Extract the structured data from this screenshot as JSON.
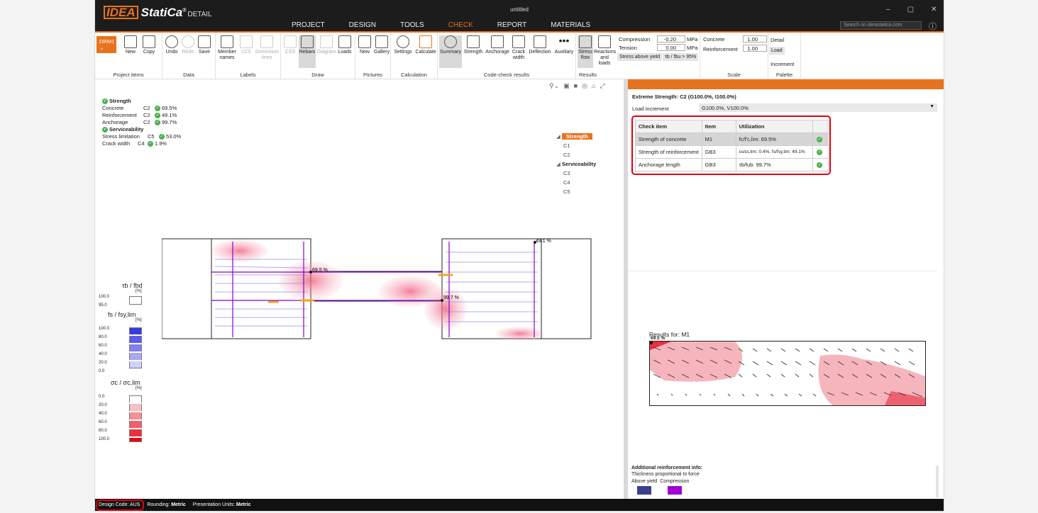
{
  "app": {
    "brand": "IDEA",
    "product": "StatiCa",
    "registered": "®",
    "module": "DETAIL",
    "doc_title": "untitled"
  },
  "menu": [
    {
      "label": "PROJECT"
    },
    {
      "label": "DESIGN"
    },
    {
      "label": "TOOLS"
    },
    {
      "label": "CHECK",
      "active": true
    },
    {
      "label": "REPORT"
    },
    {
      "label": "MATERIALS"
    }
  ],
  "search": {
    "placeholder": "Search on ideastatica.com"
  },
  "ribbon": {
    "project": {
      "drm": "DRM1",
      "new": "New",
      "copy": "Copy",
      "label": "Project items"
    },
    "data": {
      "undo": "Undo",
      "redo": "Redo",
      "save": "Save",
      "label": "Data"
    },
    "labels": {
      "member": "Member names",
      "lcs": "LCS",
      "dimension": "Dimension lines",
      "label": "Labels"
    },
    "draw": {
      "css": "CSS",
      "rebars": "Rebars",
      "diagram": "Diagram",
      "loads": "Loads",
      "label": "Draw"
    },
    "pictures": {
      "new": "New",
      "gallery": "Gallery",
      "label": "Pictures"
    },
    "calculation": {
      "settings": "Settings",
      "calculate": "Calculate",
      "label": "Calculation"
    },
    "code": {
      "summary": "Summary",
      "strength": "Strength",
      "anchorage": "Anchorage",
      "crack": "Crack width",
      "deflection": "Deflection",
      "auxiliary": "Auxiliary",
      "label": "Code-check results"
    },
    "results": {
      "stress_flow": "Stress flow",
      "reactions": "Reactions and loads",
      "compression": "Compression",
      "tension": "Tension",
      "comp_val": "-0.20",
      "tens_val": "0.00",
      "unit": "MPa",
      "stress_yield": "Stress above yield",
      "tb_ratio": "τb / fbu > 95%",
      "label": "Results"
    },
    "scale": {
      "concrete": "Concrete",
      "reinforcement": "Reinforcement",
      "concrete_val": "1.00",
      "reinf_val": "1.00",
      "label": "Scale"
    },
    "palette": {
      "detail": "Detail",
      "load": "Load",
      "increment": "Increment",
      "label": "Palette"
    }
  },
  "summary": {
    "strength_title": "Strength",
    "rows": [
      {
        "name": "Concrete",
        "case": "C2",
        "value": "69.5%"
      },
      {
        "name": "Reinforcement",
        "case": "C2",
        "value": "49.1%"
      },
      {
        "name": "Anchorage",
        "case": "C2",
        "value": "99.7%"
      }
    ],
    "serviceability_title": "Serviceability",
    "srows": [
      {
        "name": "Stress limitation",
        "case": "C5",
        "value": "53.0%"
      },
      {
        "name": "Crack width",
        "case": "C4",
        "value": "1.9%"
      }
    ]
  },
  "tree": {
    "strength": "Strength",
    "c1": "C1",
    "c2": "C2",
    "serviceability": "Serviceability",
    "c3": "C3",
    "c4": "C4",
    "c5": "C5"
  },
  "drawing": {
    "labels": {
      "a": "69.5 %",
      "b": "49.1 %",
      "c": "99.7 %"
    }
  },
  "legend": {
    "tb": {
      "title": "τb / fbd",
      "unit": "[%]",
      "values": [
        "100.0",
        "95.0"
      ],
      "color": "#f5a31a"
    },
    "fs": {
      "title": "fs / fsy,lim",
      "unit": "[%]",
      "values": [
        "100.0",
        "80.0",
        "60.0",
        "40.0",
        "20.0",
        "0.0"
      ]
    },
    "sc": {
      "title": "σc / σc,lim",
      "unit": "[%]",
      "values": [
        "0.0",
        "20.0",
        "40.0",
        "60.0",
        "80.0",
        "100.0"
      ]
    }
  },
  "right": {
    "title": "Extreme Strength: C2 (G100.0%, I100.0%)",
    "load_increment_label": "Load increment",
    "load_increment_value": "G100.0%, V100.0%",
    "table": {
      "headers": [
        "Check item",
        "Item",
        "Utilization"
      ],
      "rows": [
        [
          "Strength of concrete",
          "M1",
          "fc/f'c,lim: 69.5%"
        ],
        [
          "Strength of reinforcement",
          "GB3",
          "εs/εs,lim: 0.4%, fs/fsy,lim: 49.1%"
        ],
        [
          "Anchorage length",
          "GB3",
          "τb/fub: 99.7%"
        ]
      ]
    },
    "results_for": "Results for: M1",
    "m1_label": "69.5 %",
    "add_title": "Additional reinforcement info:",
    "add_sub": "Thickness proportional to force",
    "above_yield": "Above yield",
    "compression": "Compression",
    "colors": {
      "above_yield": "#3a3f8f",
      "compression": "#a000d8"
    }
  },
  "status": {
    "design_code": "Design Code: AUS",
    "rounding_label": "Rounding:",
    "rounding": "Metric",
    "units_label": "Presentation Units:",
    "units": "Metric"
  }
}
